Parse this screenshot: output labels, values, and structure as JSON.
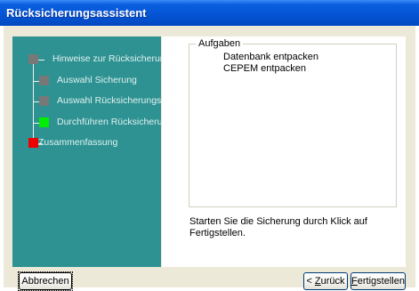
{
  "window": {
    "title": "Rücksicherungsassistent"
  },
  "colors": {
    "sidebar": "#2e9292",
    "step_done": "#787878",
    "step_current": "#00ee00",
    "step_final": "#ee0000"
  },
  "steps": [
    {
      "label": "Hinweise zur Rücksicherung",
      "state": "done"
    },
    {
      "label": "Auswahl Sicherung",
      "state": "done"
    },
    {
      "label": "Auswahl Rücksicherungsart",
      "state": "done"
    },
    {
      "label": "Durchführen Rücksicherung",
      "state": "current"
    },
    {
      "label": "Zusammenfassung",
      "state": "final"
    }
  ],
  "tasks": {
    "legend": "Aufgaben",
    "items": [
      "Datenbank entpacken",
      "CEPEM entpacken"
    ]
  },
  "hint": "Starten Sie die Sicherung durch Klick auf Fertigstellen.",
  "buttons": {
    "cancel": "Abbrechen",
    "back_prefix": "< ",
    "back_key": "Z",
    "back_rest": "urück",
    "finish_key": "F",
    "finish_rest": "ertigstellen"
  }
}
